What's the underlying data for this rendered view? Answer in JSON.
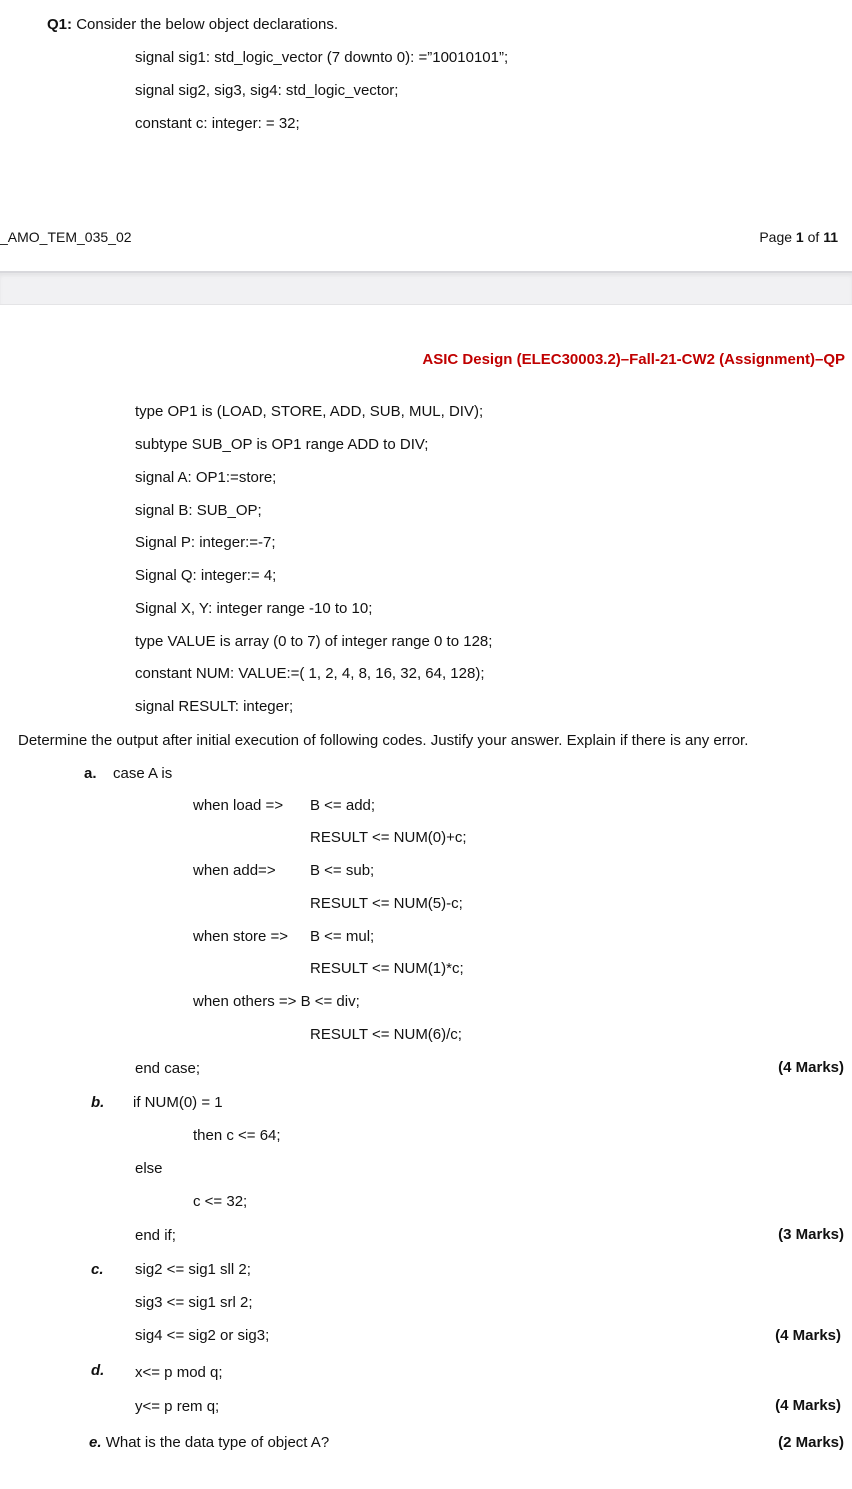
{
  "page1": {
    "question_label": "Q1:",
    "question_text": "Consider the below object declarations.",
    "declarations": [
      "signal sig1: std_logic_vector (7 downto 0): =”10010101”;",
      "signal sig2, sig3, sig4: std_logic_vector;",
      "constant c: integer: = 32;"
    ],
    "footer_doc_code": "_AMO_TEM_035_02",
    "footer_page_prefix": "Page ",
    "footer_page_current": "1",
    "footer_page_of": " of ",
    "footer_page_total": "11"
  },
  "page2": {
    "header_title": "ASIC Design (ELEC30003.2)–Fall-21-CW2 (Assignment)–QP",
    "declarations": [
      "type OP1 is (LOAD, STORE, ADD, SUB, MUL, DIV);",
      "subtype SUB_OP is OP1 range ADD to DIV;",
      "signal A: OP1:=store;",
      "signal B: SUB_OP;",
      "Signal P: integer:=-7;",
      "Signal Q: integer:= 4;",
      "Signal X, Y: integer range -10 to 10;",
      "type VALUE is array (0 to 7) of integer range 0 to 128;",
      "constant NUM: VALUE:=( 1, 2, 4, 8, 16, 32, 64, 128);",
      "signal RESULT: integer;"
    ],
    "instruction": "Determine the output after initial execution of following codes. Justify your answer. Explain if there is any error.",
    "part_a": {
      "label": "a.",
      "case_head": "case A is",
      "branches": [
        {
          "when": "when load =>",
          "stmt1": "B <= add;",
          "stmt2": "RESULT <= NUM(0)+c;"
        },
        {
          "when": "when add=>",
          "stmt1": "B <= sub;",
          "stmt2": "RESULT <= NUM(5)-c;"
        },
        {
          "when": "when store =>",
          "stmt1": "B <= mul;",
          "stmt2": "RESULT <= NUM(1)*c;"
        },
        {
          "when": "when others => B <= div;",
          "stmt1": "",
          "stmt2": "RESULT <= NUM(6)/c;"
        }
      ],
      "end": "end case;",
      "marks": "(4 Marks)"
    },
    "part_b": {
      "label": "b.",
      "lines": [
        "if NUM(0) = 1",
        "then c <= 64;",
        "else",
        "c <= 32;",
        "end if;"
      ],
      "marks": "(3 Marks)"
    },
    "part_c": {
      "label": "c.",
      "lines": [
        "sig2 <= sig1 sll 2;",
        "sig3 <= sig1 srl 2;",
        "sig4 <= sig2 or sig3;"
      ],
      "marks": "(4 Marks)"
    },
    "part_d": {
      "label": "d.",
      "lines": [
        "x<= p mod q;",
        "y<= p rem q;"
      ],
      "marks": "(4 Marks)"
    },
    "part_e": {
      "label": "e.",
      "text": "What is the data type of object A?",
      "marks": "(2 Marks)"
    }
  }
}
